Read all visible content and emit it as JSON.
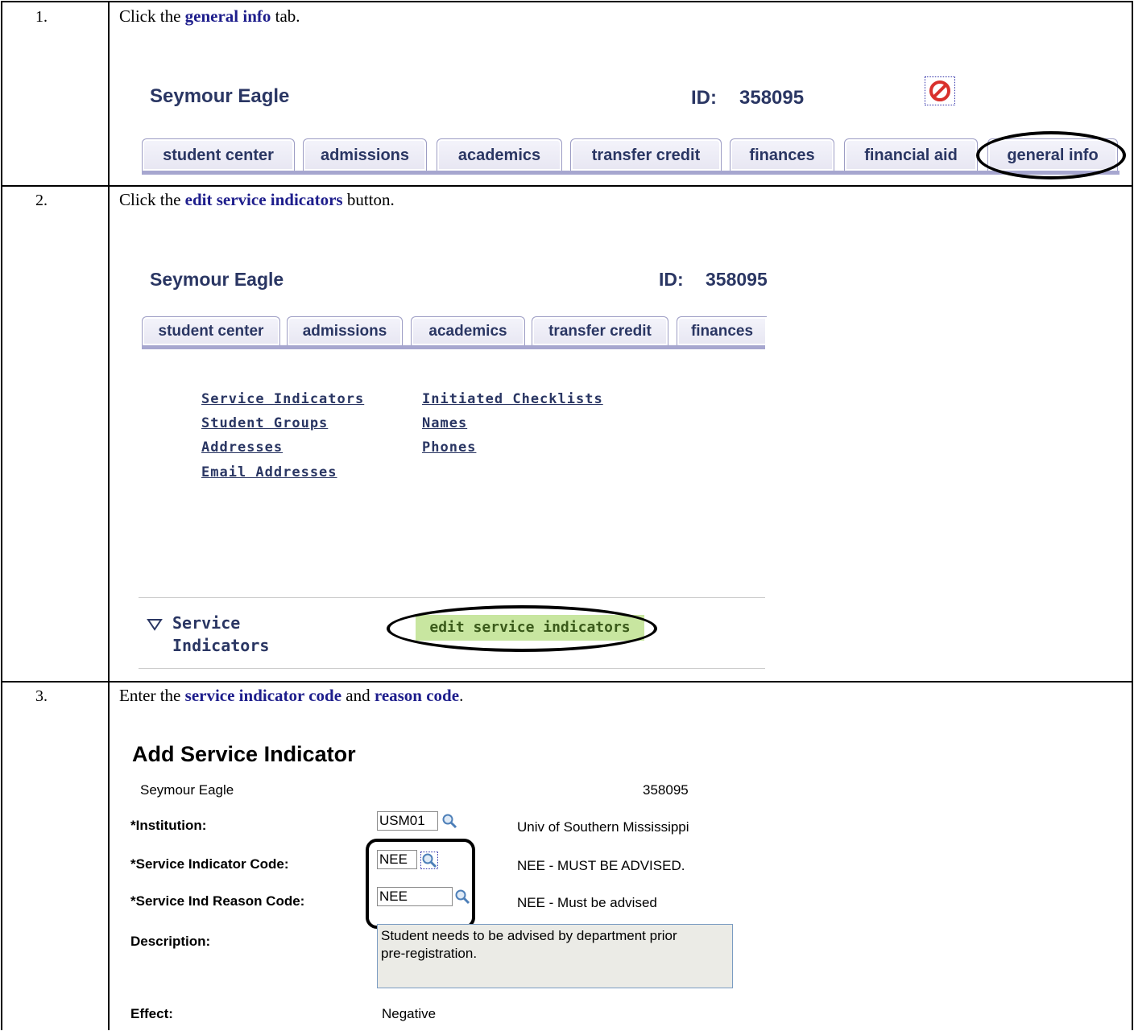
{
  "steps": [
    {
      "number": "1.",
      "pre": "Click the ",
      "bold": "general info",
      "post": " tab."
    },
    {
      "number": "2.",
      "pre": "Click the ",
      "bold": "edit service indicators",
      "post": " button."
    },
    {
      "number": "3.",
      "pre": "Enter the ",
      "bold": "service indicator code",
      "mid": " and ",
      "bold2": "reason code",
      "post": "."
    }
  ],
  "student": {
    "name": "Seymour Eagle",
    "id_label": "ID:",
    "id_value": "358095"
  },
  "tabs1": [
    "student center",
    "admissions",
    "academics",
    "transfer credit",
    "finances",
    "financial aid",
    "general info"
  ],
  "tabs2": [
    "student center",
    "admissions",
    "academics",
    "transfer credit",
    "finances"
  ],
  "general_links": [
    "Service Indicators",
    "Initiated Checklists",
    "Student Groups",
    "Names",
    "Addresses",
    "Phones",
    "Email Addresses"
  ],
  "service_section": {
    "line1": "Service",
    "line2": "Indicators",
    "button": "edit service indicators"
  },
  "add_form": {
    "title": "Add Service Indicator",
    "name": "Seymour Eagle",
    "id": "358095",
    "institution_label": "*Institution:",
    "institution_value": "USM01",
    "institution_desc": "Univ of Southern Mississippi",
    "code_label": "*Service Indicator Code:",
    "code_value": "NEE",
    "code_desc": "NEE - MUST BE ADVISED.",
    "reason_label": "*Service Ind Reason Code:",
    "reason_value": "NEE",
    "reason_desc": "NEE - Must be advised",
    "description_label": "Description:",
    "description_line1": "Student needs to be advised by department prior",
    "description_line2": "pre-registration.",
    "effect_label": "Effect:",
    "effect_value": "Negative"
  },
  "icons": {
    "stop": "no-entry-icon",
    "lookup": "magnifier-icon",
    "expand": "triangle-down-icon"
  },
  "colors": {
    "tab_text": "#2a3663",
    "instruction_bold": "#1e1e8c",
    "button_bg": "#c8e6a0",
    "stop_red": "#d9302c"
  }
}
